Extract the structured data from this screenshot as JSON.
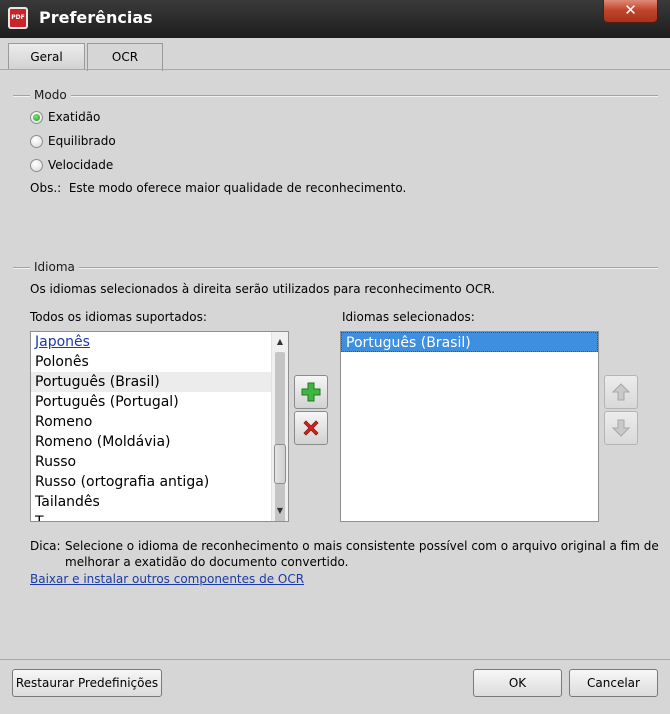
{
  "window": {
    "title": "Preferências",
    "icon_name": "pdf-app-icon",
    "icon_text": "PDF",
    "close_label": "✕"
  },
  "tabs": [
    {
      "label": "Geral",
      "active": false
    },
    {
      "label": "OCR",
      "active": true
    }
  ],
  "mode": {
    "group_label": "Modo",
    "options": [
      {
        "label": "Exatidão",
        "checked": true
      },
      {
        "label": "Equilibrado",
        "checked": false
      },
      {
        "label": "Velocidade",
        "checked": false
      }
    ],
    "note_prefix": "Obs.:",
    "note": "Este modo oferece maior qualidade de reconhecimento."
  },
  "language": {
    "group_label": "Idioma",
    "description": "Os idiomas selecionados à direita serão utilizados para reconhecimento OCR.",
    "all_label": "Todos os idiomas suportados:",
    "selected_label": "Idiomas selecionados:",
    "all_items": [
      "Japonês",
      "Polonês",
      "Português (Brasil)",
      "Português (Portugal)",
      "Romeno",
      "Romeno (Moldávia)",
      "Russo",
      "Russo (ortografia antiga)",
      "Tailandês",
      "T"
    ],
    "selected_items": [
      "Português (Brasil)"
    ]
  },
  "tip": {
    "prefix": "Dica:",
    "line1": "Selecione o idioma de reconhecimento o mais consistente possível com o arquivo original a fim de",
    "line2": "melhorar a exatidão do documento convertido.",
    "link": "Baixar e instalar outros componentes de OCR"
  },
  "footer": {
    "restore_label": "Restaurar Predefinições",
    "ok_label": "OK",
    "cancel_label": "Cancelar"
  },
  "colors": {
    "accent_selected": "#3e8fe0",
    "add_green": "#3fb63f",
    "remove_red": "#d4261e"
  }
}
